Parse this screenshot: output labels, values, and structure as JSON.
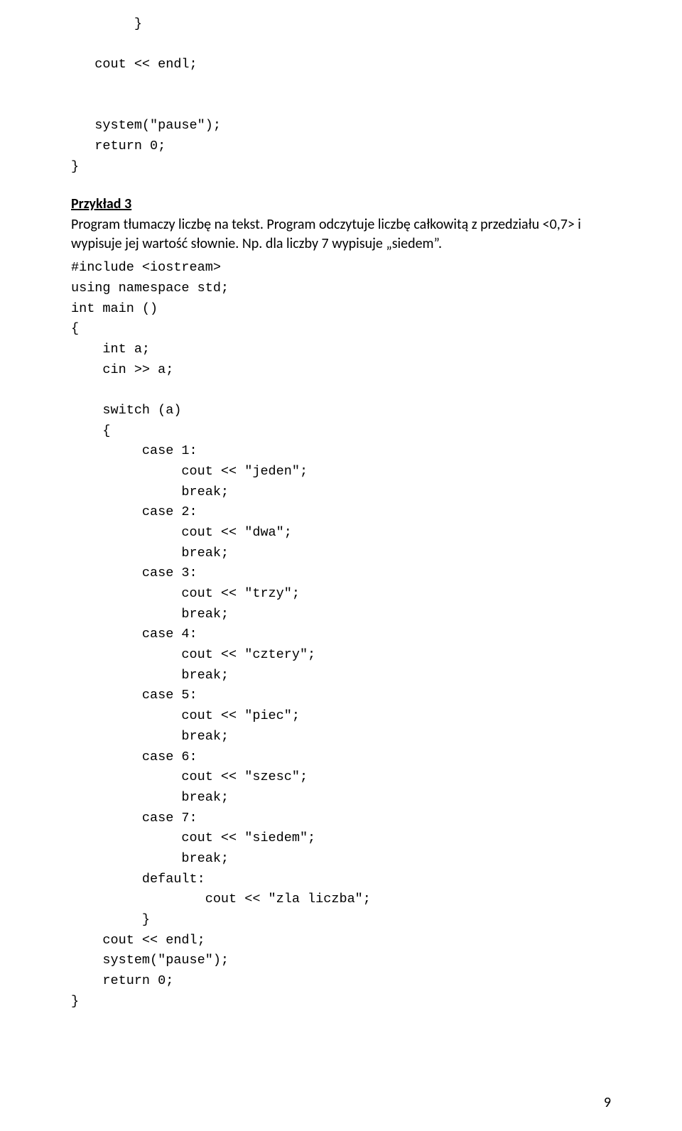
{
  "code_top": "        }\n\n   cout << endl;\n\n\n   system(\"pause\");\n   return 0;\n}",
  "heading": "Przykład 3",
  "paragraph": "Program tłumaczy liczbę na tekst. Program odczytuje liczbę całkowitą z przedziału <0,7> i wypisuje jej wartość słownie. Np. dla liczby 7 wypisuje „siedem”.",
  "code_main": "#include <iostream>\nusing namespace std;\nint main ()\n{\n    int a;\n    cin >> a;\n\n    switch (a)\n    {\n         case 1:\n              cout << \"jeden\";\n              break;\n         case 2:\n              cout << \"dwa\";\n              break;\n         case 3:\n              cout << \"trzy\";\n              break;\n         case 4:\n              cout << \"cztery\";\n              break;\n         case 5:\n              cout << \"piec\";\n              break;\n         case 6:\n              cout << \"szesc\";\n              break;\n         case 7:\n              cout << \"siedem\";\n              break;\n         default:\n                 cout << \"zla liczba\";\n         }\n    cout << endl;\n    system(\"pause\");\n    return 0;\n}",
  "page_number": "9"
}
